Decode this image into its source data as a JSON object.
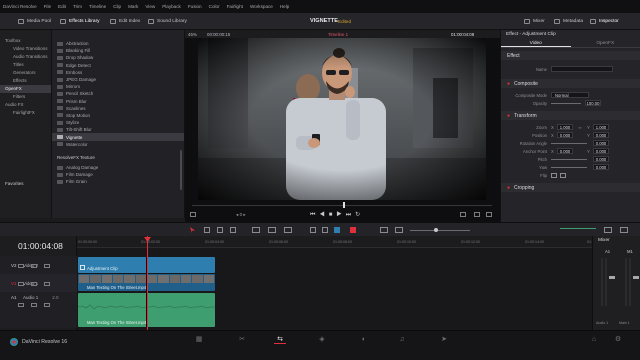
{
  "menubar": {
    "items": [
      "DaVinci Resolve",
      "File",
      "Edit",
      "Trim",
      "Timeline",
      "Clip",
      "Mark",
      "View",
      "Playback",
      "Fusion",
      "Color",
      "Fairlight",
      "Workspace",
      "Help"
    ]
  },
  "toolbar": {
    "media_pool": "Media Pool",
    "effects_library": "Effects Library",
    "edit_index": "Edit Index",
    "sound_library": "Sound Library",
    "project_title": "VIGNETTE",
    "edited": "Edited",
    "mixer": "Mixer",
    "metadata": "Metadata",
    "inspector": "Inspector"
  },
  "library": {
    "tree": [
      "Toolbox",
      "Video Transitions",
      "Audio Transitions",
      "Titles",
      "Generators",
      "Effects",
      "OpenFX",
      "Filters",
      "Audio FX",
      "FairlightFX"
    ],
    "favorites": "Favorites",
    "effects": [
      "Abstraction",
      "Blanking Fill",
      "Drop Shadow",
      "Edge Detect",
      "Emboss",
      "JPEG Damage",
      "Mirrors",
      "Pencil Sketch",
      "Prism Blur",
      "Scanlines",
      "Stop Motion",
      "Stylize",
      "Tilt-Shift Blur",
      "Vignette",
      "Watercolor"
    ],
    "group_header": "ResolveFX Texture",
    "texture": [
      "Analog Damage",
      "Film Damage",
      "Film Grain"
    ]
  },
  "viewer": {
    "zoom": "45%",
    "timecode_left": "00:00:00:15",
    "timeline_name": "Timeline 1",
    "timecode_right": "01:00:04:08"
  },
  "inspector": {
    "title": "Effect - Adjustment Clip",
    "tabs": [
      "Video",
      "OpenFX"
    ],
    "effect_section": "Effect",
    "name_label": "Name",
    "composite_section": "Composite",
    "composite_mode_label": "Composite Mode",
    "composite_mode_value": "Normal",
    "opacity_label": "Opacity",
    "opacity_value": "100.00",
    "transform_section": "Transform",
    "zoom_label": "Zoom",
    "zoom_x": "1.000",
    "zoom_y": "1.000",
    "position_label": "Position",
    "position_x": "0.000",
    "position_y": "0.000",
    "rotation_label": "Rotation Angle",
    "rotation_value": "0.000",
    "anchor_label": "Anchor Point",
    "anchor_x": "0.000",
    "anchor_y": "0.000",
    "pitch_label": "Pitch",
    "pitch_value": "0.000",
    "yaw_label": "Yaw",
    "yaw_value": "0.000",
    "flip_label": "Flip",
    "cropping_section": "Cropping"
  },
  "timeline": {
    "timecode": "01:00:04:08",
    "ruler": [
      "01:00:00:00",
      "01:00:02:00",
      "01:00:04:00",
      "01:00:06:00",
      "01:00:08:00",
      "01:00:10:00",
      "01:00:12:00",
      "01:00:14:00",
      "01:00:16:00"
    ],
    "tracks": [
      {
        "id": "V2",
        "name": "Video 2"
      },
      {
        "id": "V1",
        "name": "Video 1"
      },
      {
        "id": "A1",
        "name": "Audio 1",
        "level": "2.0"
      }
    ],
    "clips": {
      "adjustment": "Adjustment Clip",
      "video": "Man Texting On The Street.mp4",
      "audio": "Man Texting On The Street.mp4"
    }
  },
  "mixer": {
    "title": "Mixer",
    "channels": [
      "A1",
      "M1"
    ],
    "level_label": "Audio 1",
    "master_label": "Main 1"
  },
  "pagebar": {
    "app": "DaVinci Resolve 16"
  },
  "colors": {
    "accent_red": "#e0303b",
    "clip_blue": "#2e7fb0",
    "clip_green": "#3f9e6f",
    "edited": "#d4a02e"
  }
}
